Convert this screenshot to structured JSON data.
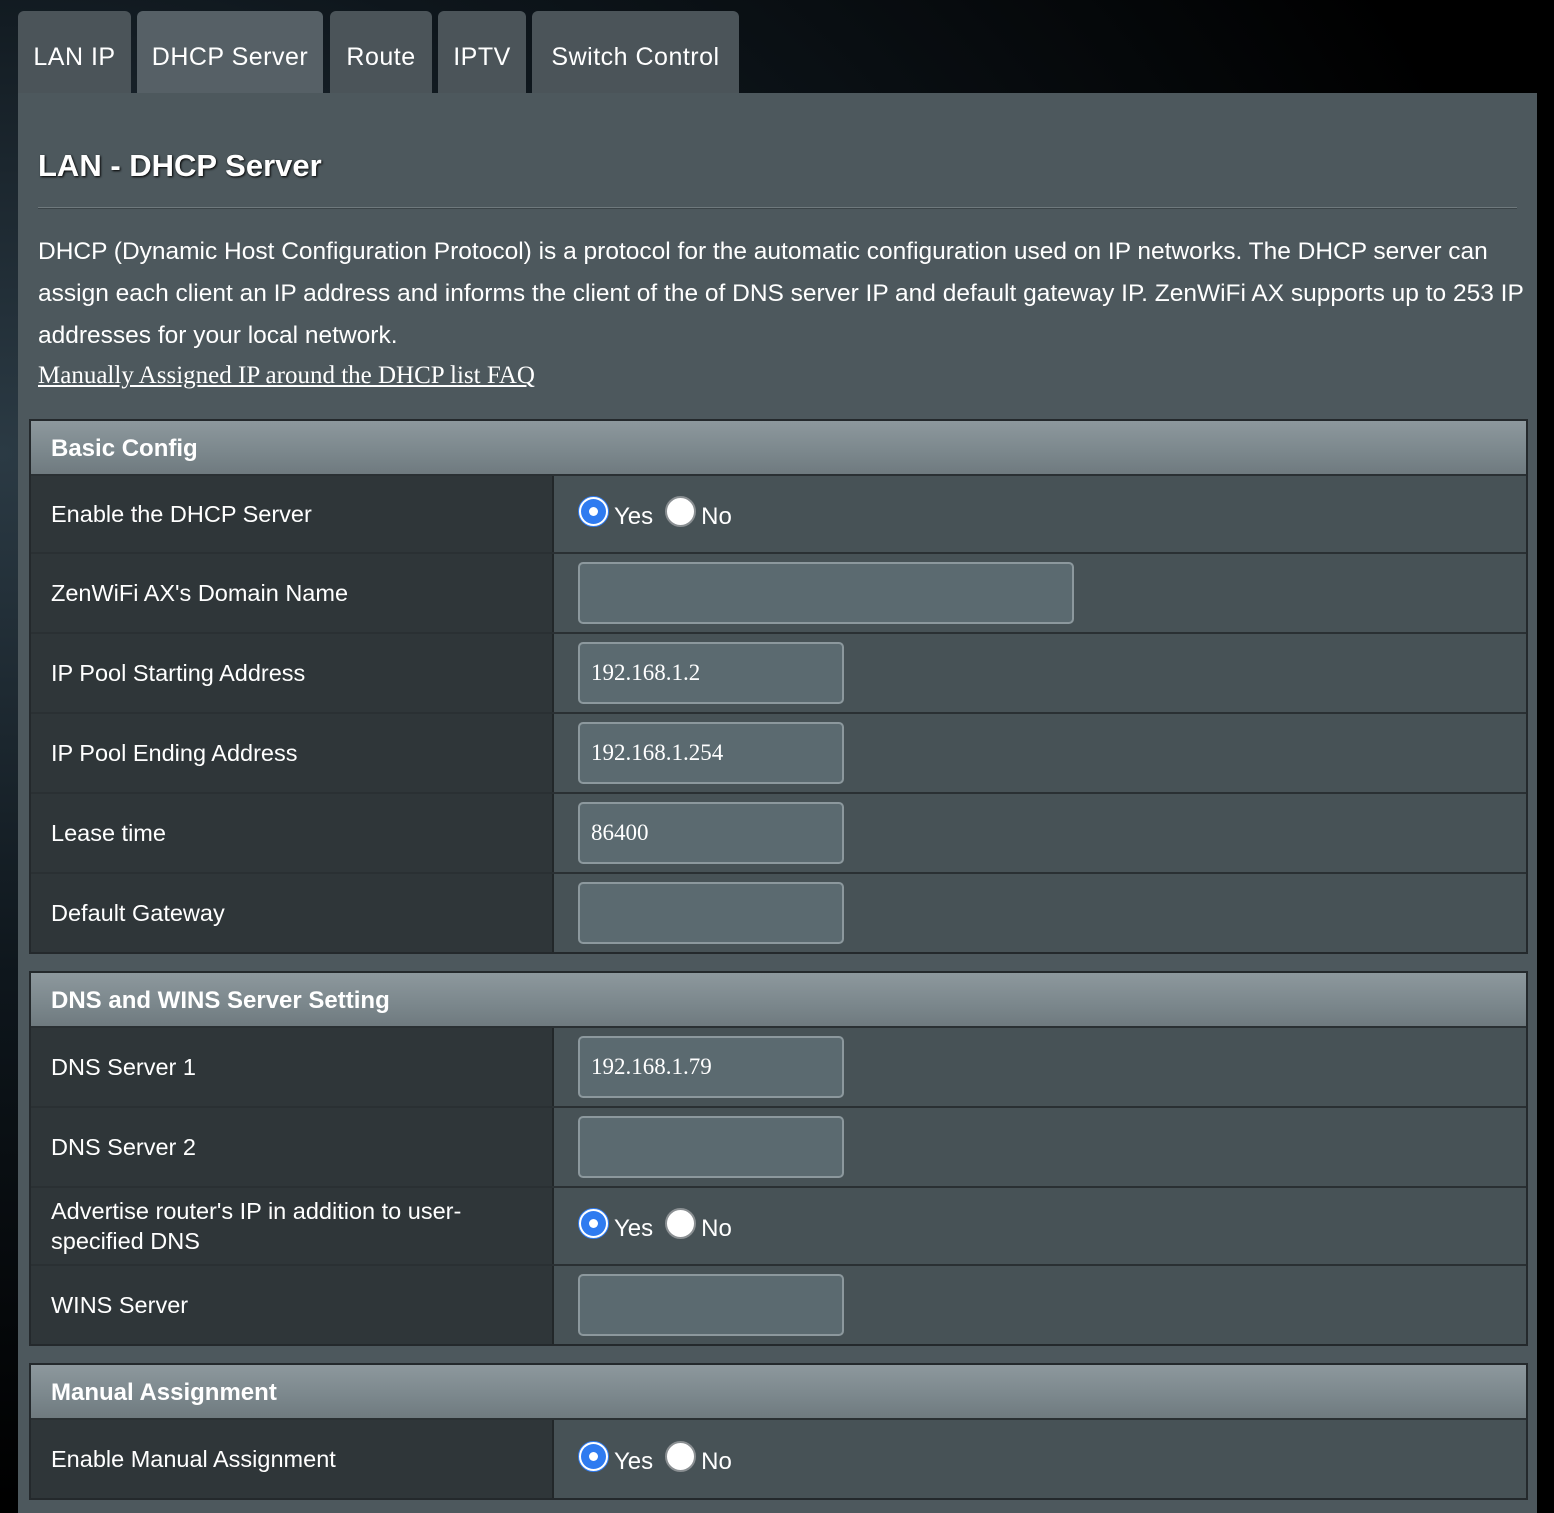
{
  "tabs": [
    {
      "label": "LAN IP"
    },
    {
      "label": "DHCP Server",
      "active": true
    },
    {
      "label": "Route"
    },
    {
      "label": "IPTV"
    },
    {
      "label": "Switch Control"
    }
  ],
  "page": {
    "title": "LAN - DHCP Server",
    "description": "DHCP (Dynamic Host Configuration Protocol) is a protocol for the automatic configuration used on IP networks. The DHCP server can assign each client an IP address and informs the client of the of DNS server IP and default gateway IP. ZenWiFi AX supports up to 253 IP addresses for your local network.",
    "faq_link": "Manually Assigned IP around the DHCP list FAQ"
  },
  "radio_labels": {
    "yes": "Yes",
    "no": "No"
  },
  "basic_config": {
    "header": "Basic Config",
    "enable_dhcp": {
      "label": "Enable the DHCP Server",
      "selected": "Yes"
    },
    "domain_name": {
      "label": "ZenWiFi AX's Domain Name",
      "value": ""
    },
    "pool_start": {
      "label": "IP Pool Starting Address",
      "value": "192.168.1.2"
    },
    "pool_end": {
      "label": "IP Pool Ending Address",
      "value": "192.168.1.254"
    },
    "lease_time": {
      "label": "Lease time",
      "value": "86400"
    },
    "default_gateway": {
      "label": "Default Gateway",
      "value": ""
    }
  },
  "dns_wins": {
    "header": "DNS and WINS Server Setting",
    "dns1": {
      "label": "DNS Server 1",
      "value": "192.168.1.79"
    },
    "dns2": {
      "label": "DNS Server 2",
      "value": ""
    },
    "advertise": {
      "label": "Advertise router's IP in addition to user-specified DNS",
      "selected": "Yes"
    },
    "wins": {
      "label": "WINS Server",
      "value": ""
    }
  },
  "manual_assignment": {
    "header": "Manual Assignment",
    "enable_manual": {
      "label": "Enable Manual Assignment",
      "selected": "Yes"
    }
  },
  "colors": {
    "accent_radio": "#2f7bf0",
    "panel": "#4d585d",
    "label_cell": "#2f3639",
    "value_cell": "#475256"
  }
}
